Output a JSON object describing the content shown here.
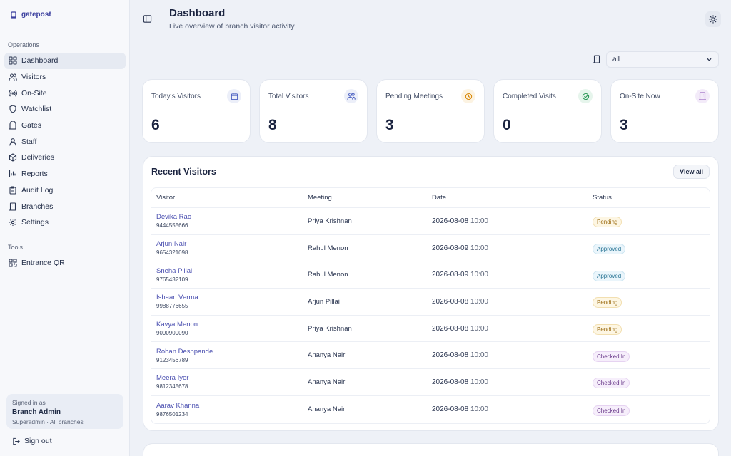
{
  "app": {
    "brand": "gatepost"
  },
  "sidebar": {
    "operations_label": "Operations",
    "items": [
      {
        "label": "Dashboard",
        "icon": "dashboard-icon",
        "active": true
      },
      {
        "label": "Visitors",
        "icon": "users-icon"
      },
      {
        "label": "On-Site",
        "icon": "broadcast-icon"
      },
      {
        "label": "Watchlist",
        "icon": "shield-icon"
      },
      {
        "label": "Gates",
        "icon": "gate-icon"
      },
      {
        "label": "Staff",
        "icon": "user-icon"
      },
      {
        "label": "Deliveries",
        "icon": "package-icon"
      },
      {
        "label": "Reports",
        "icon": "bar-chart-icon"
      },
      {
        "label": "Audit Log",
        "icon": "clipboard-icon"
      },
      {
        "label": "Branches",
        "icon": "building-icon"
      },
      {
        "label": "Settings",
        "icon": "gear-icon"
      }
    ],
    "tools_label": "Tools",
    "tools": [
      {
        "label": "Entrance QR",
        "icon": "qr-icon"
      }
    ],
    "user": {
      "signed_in_label": "Signed in as",
      "name": "Branch Admin",
      "role": "Superadmin · All branches"
    },
    "sign_out": "Sign out"
  },
  "header": {
    "title": "Dashboard",
    "subtitle": "Live overview of branch visitor activity"
  },
  "filter": {
    "branch_value": "all"
  },
  "stats": [
    {
      "label": "Today's Visitors",
      "value": "6",
      "icon": "calendar-icon",
      "color": "#4a5fc1",
      "bg": "#eceff9"
    },
    {
      "label": "Total Visitors",
      "value": "8",
      "icon": "users-icon",
      "color": "#4a5fc1",
      "bg": "#eceff9"
    },
    {
      "label": "Pending Meetings",
      "value": "3",
      "icon": "clock-icon",
      "color": "#d98a0c",
      "bg": "#fcf3e2"
    },
    {
      "label": "Completed Visits",
      "value": "0",
      "icon": "check-circle-icon",
      "color": "#2e9a5a",
      "bg": "#e6f5ec"
    },
    {
      "label": "On-Site Now",
      "value": "3",
      "icon": "building-icon",
      "color": "#8a4fb8",
      "bg": "#f3ebf9"
    }
  ],
  "recent": {
    "title": "Recent Visitors",
    "view_all": "View all",
    "columns": [
      "Visitor",
      "Meeting",
      "Date",
      "Status"
    ],
    "rows": [
      {
        "name": "Devika Rao",
        "phone": "9444555666",
        "meeting": "Priya Krishnan",
        "date": "2026-08-08",
        "time": "10:00",
        "status": "Pending",
        "kind": "pending"
      },
      {
        "name": "Arjun Nair",
        "phone": "9654321098",
        "meeting": "Rahul Menon",
        "date": "2026-08-09",
        "time": "10:00",
        "status": "Approved",
        "kind": "approved"
      },
      {
        "name": "Sneha Pillai",
        "phone": "9765432109",
        "meeting": "Rahul Menon",
        "date": "2026-08-09",
        "time": "10:00",
        "status": "Approved",
        "kind": "approved"
      },
      {
        "name": "Ishaan Verma",
        "phone": "9988776655",
        "meeting": "Arjun Pillai",
        "date": "2026-08-08",
        "time": "10:00",
        "status": "Pending",
        "kind": "pending"
      },
      {
        "name": "Kavya Menon",
        "phone": "9090909090",
        "meeting": "Priya Krishnan",
        "date": "2026-08-08",
        "time": "10:00",
        "status": "Pending",
        "kind": "pending"
      },
      {
        "name": "Rohan Deshpande",
        "phone": "9123456789",
        "meeting": "Ananya Nair",
        "date": "2026-08-08",
        "time": "10:00",
        "status": "Checked In",
        "kind": "checked"
      },
      {
        "name": "Meera Iyer",
        "phone": "9812345678",
        "meeting": "Ananya Nair",
        "date": "2026-08-08",
        "time": "10:00",
        "status": "Checked In",
        "kind": "checked"
      },
      {
        "name": "Aarav Khanna",
        "phone": "9876501234",
        "meeting": "Ananya Nair",
        "date": "2026-08-08",
        "time": "10:00",
        "status": "Checked In",
        "kind": "checked"
      }
    ]
  }
}
